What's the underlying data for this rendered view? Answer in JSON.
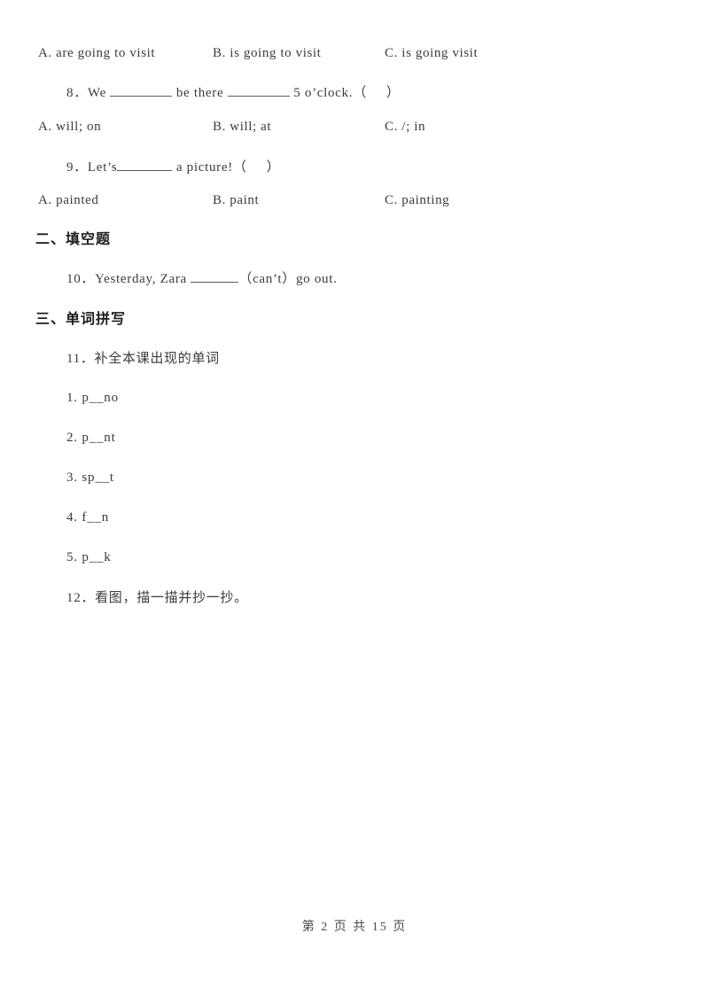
{
  "document": {
    "type": "exam-worksheet",
    "page_background": "#ffffff",
    "text_color": "#3b3b3b",
    "heading_color": "#1c1c1c"
  },
  "option_rows": [
    {
      "id": "q7-options",
      "a": "A. are going to visit",
      "b": "B. is going to visit",
      "c": "C. is going visit"
    },
    {
      "id": "q8-options",
      "a": "A. will; on",
      "b": "B. will; at",
      "c": "C. /; in"
    },
    {
      "id": "q9-options",
      "a": "A. painted",
      "b": "B. paint",
      "c": "C. painting"
    }
  ],
  "questions": {
    "q8": {
      "number": "8．",
      "part1": "We ",
      "part2": " be there ",
      "part3": " 5 o’clock.（",
      "part4": "）"
    },
    "q9": {
      "number": "9．",
      "part1": "Let’s",
      "part2": " a picture!（",
      "part3": "）"
    },
    "q10": {
      "number": "10．",
      "part1": "Yesterday, Zara ",
      "part2": "（can’t）go out."
    }
  },
  "sections": [
    {
      "id": "section-2",
      "label": "二、填空题"
    },
    {
      "id": "section-3",
      "label": "三、单词拼写"
    }
  ],
  "subitems": {
    "item11": "11．补全本课出现的单词",
    "item12": "12．看图，描一描并抄一抄。"
  },
  "word_list": [
    "1.  p__no",
    "2.  p__nt",
    "3.  sp__t",
    "4.  f__n",
    "5.  p__k"
  ],
  "footer": {
    "text": "第 2 页 共 15 页"
  }
}
